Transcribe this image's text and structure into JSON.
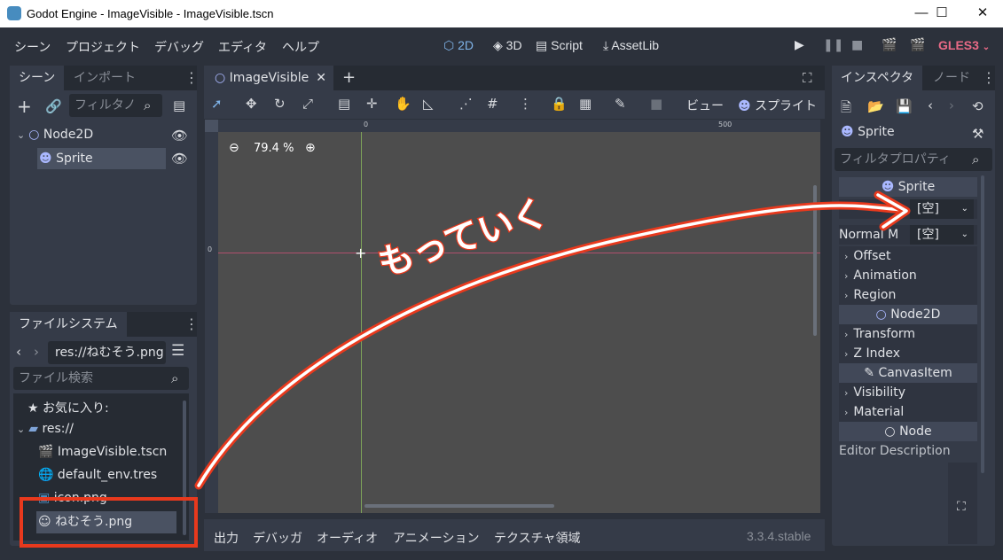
{
  "window": {
    "title": "Godot Engine - ImageVisible - ImageVisible.tscn",
    "minimize": "—",
    "maximize": "☐",
    "close": "✕"
  },
  "menu": [
    "シーン",
    "プロジェクト",
    "デバッグ",
    "エディタ",
    "ヘルプ"
  ],
  "workspaces": [
    "2D",
    "3D",
    "Script",
    "AssetLib"
  ],
  "renderer": "GLES3",
  "scene_dock": {
    "tabs": [
      "シーン",
      "インポート"
    ],
    "filter_placeholder": "フィルタノ",
    "nodes": [
      {
        "label": "Node2D"
      },
      {
        "label": "Sprite"
      }
    ]
  },
  "filesystem": {
    "tab": "ファイルシステム",
    "path": "res://ねむそう.png",
    "search_placeholder": "ファイル検索",
    "favorites": "お気に入り:",
    "root": "res://",
    "files": [
      "ImageVisible.tscn",
      "default_env.tres",
      "icon.png",
      "ねむそう.png"
    ]
  },
  "editor": {
    "scene_tab": "ImageVisible",
    "toolbar_view": "ビュー",
    "toolbar_sprite": "スプライト",
    "zoom": "79.4 %",
    "ruler_labels": [
      "0",
      "500"
    ],
    "vruler_label": "0"
  },
  "annotation": {
    "handwriting": "もっていく"
  },
  "bottom_panel": {
    "tabs": [
      "出力",
      "デバッガ",
      "オーディオ",
      "アニメーション",
      "テクスチャ領域"
    ],
    "version": "3.3.4.stable"
  },
  "inspector": {
    "tabs": [
      "インスペクタ",
      "ノード"
    ],
    "object": "Sprite",
    "filter_placeholder": "フィルタプロパティ",
    "section_sprite": "Sprite",
    "texture_value": "[空]",
    "normal_map_label": "Normal M",
    "normal_map_value": "[空]",
    "groups": [
      "Offset",
      "Animation",
      "Region"
    ],
    "section_node2d": "Node2D",
    "node2d_groups": [
      "Transform",
      "Z Index"
    ],
    "section_canvasitem": "CanvasItem",
    "canvas_groups": [
      "Visibility",
      "Material"
    ],
    "section_node": "Node",
    "editor_description": "Editor Description"
  },
  "colors": {
    "accent": "#7fb3e8",
    "highlight_box": "#e8391d",
    "arrow_stroke": "#e8391d",
    "gles": "#e96a86"
  }
}
